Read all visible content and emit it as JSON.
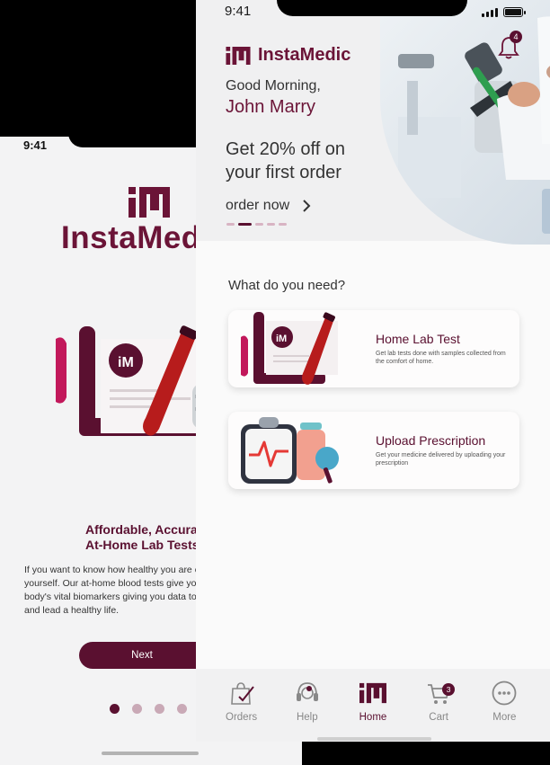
{
  "back_screen": {
    "time": "9:41",
    "brand": "InstaMedic",
    "headline_line1": "Affordable, Accurate,",
    "headline_line2": "At-Home Lab Tests",
    "description": "If you want to know how healthy you are on the inside of yourself. Our at-home blood tests give you need to track your body's vital biomarkers giving you data to find peace of mind and lead a healthy life.",
    "next_label": "Next",
    "dots_count": 4,
    "dots_active": 1
  },
  "status": {
    "time": "9:41"
  },
  "hero": {
    "brand": "InstaMedic",
    "greeting": "Good Morning,",
    "user_name": "John Marry",
    "offer": "Get 20% off on your first order",
    "cta": "order now",
    "notification_count": "4",
    "carousel_slides": 5,
    "carousel_active": 2
  },
  "services": {
    "title": "What do you need?",
    "items": [
      {
        "title": "Home Lab Test",
        "subtitle": "Get lab tests done with samples collected from the comfort of home.",
        "icon": "lab-test-icon"
      },
      {
        "title": "Upload Prescription",
        "subtitle": "Get your medicine delivered by uploading your prescription",
        "icon": "prescription-clipboard-icon"
      }
    ]
  },
  "tabbar": {
    "items": [
      {
        "label": "Orders",
        "icon": "shopping-bag-check-icon"
      },
      {
        "label": "Help",
        "icon": "headset-icon"
      },
      {
        "label": "Home",
        "icon": "home-logo-icon"
      },
      {
        "label": "Cart",
        "icon": "cart-icon"
      },
      {
        "label": "More",
        "icon": "more-dots-icon"
      }
    ],
    "active": "Home",
    "cart_count": "3"
  },
  "colors": {
    "brand": "#6b1437",
    "brand_dark": "#5a1030",
    "dot_inactive": "#c9a9b6"
  }
}
